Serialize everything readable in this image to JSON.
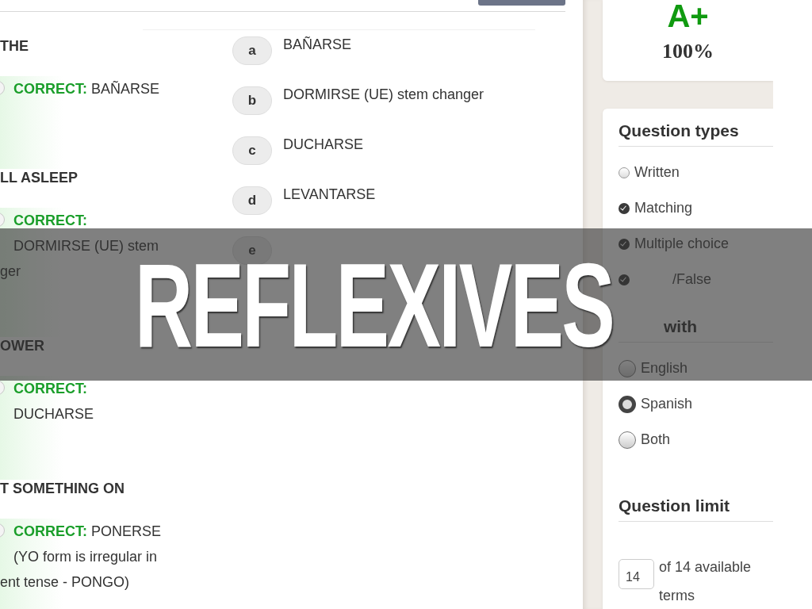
{
  "questions": [
    {
      "term": "THE",
      "selected": false,
      "correct_label": "CORRECT:",
      "answer": "BAÑARSE"
    },
    {
      "term": "LL ASLEEP",
      "selected": false,
      "correct_label": "CORRECT:",
      "more_lines": [
        "DORMIRSE (UE) stem"
      ],
      "cut_line": "ger"
    },
    {
      "term": "OWER",
      "selected": false,
      "correct_label": "CORRECT:",
      "more_lines": [
        "DUCHARSE"
      ]
    },
    {
      "term": "T SOMETHING ON",
      "selected": false,
      "correct_label": "CORRECT:",
      "answer": "PONERSE",
      "more_lines": [
        "(YO form is irregular in"
      ],
      "cut_line": "ent tense - PONGO)"
    }
  ],
  "options": [
    {
      "letter": "a",
      "text": "BAÑARSE"
    },
    {
      "letter": "b",
      "text": "DORMIRSE (UE) stem changer"
    },
    {
      "letter": "c",
      "text": "DUCHARSE"
    },
    {
      "letter": "d",
      "text": "LEVANTARSE"
    },
    {
      "letter": "e"
    }
  ],
  "score": {
    "grade": "A+",
    "percent": "100%"
  },
  "question_types": {
    "heading": "Question types",
    "items": [
      {
        "label": "Written",
        "checked": false
      },
      {
        "label": "Matching",
        "checked": true
      },
      {
        "label": "Multiple choice",
        "checked": true
      },
      {
        "label": "/False",
        "checked": true
      }
    ]
  },
  "start_with": {
    "heading": "with",
    "items": [
      {
        "label": "English",
        "selected": false
      },
      {
        "label": "Spanish",
        "selected": true
      },
      {
        "label": "Both",
        "selected": false
      }
    ]
  },
  "question_limit": {
    "heading": "Question limit",
    "value": "14",
    "text": "of 14 available terms"
  },
  "banner": {
    "title": "REFLEXIVES"
  }
}
